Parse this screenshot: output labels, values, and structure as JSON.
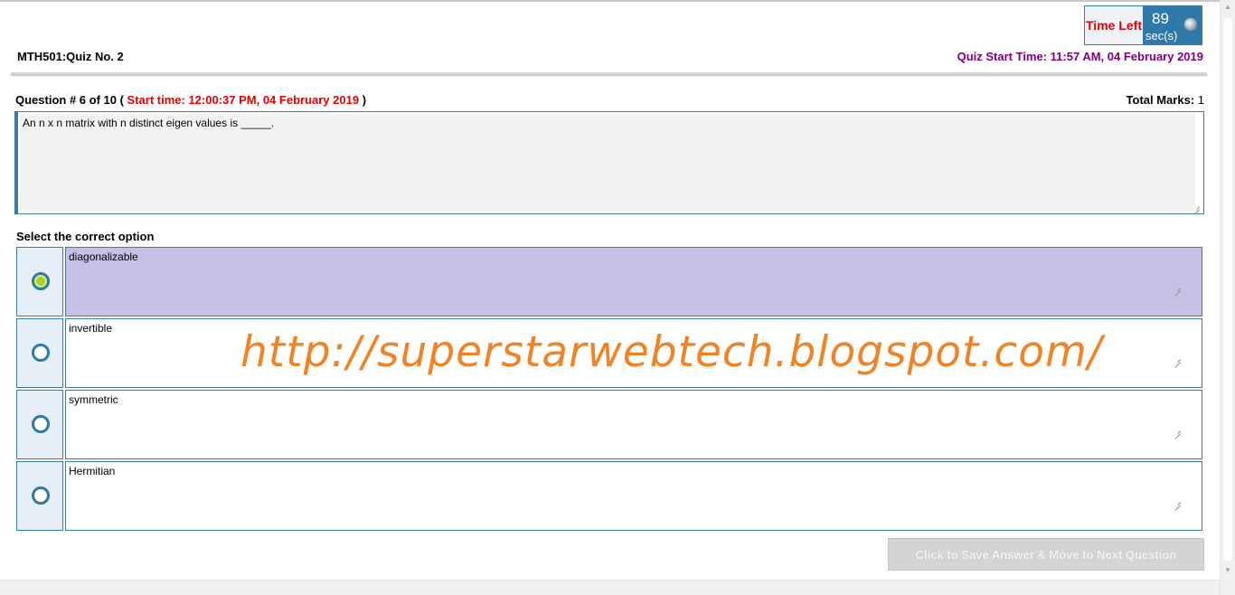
{
  "timer": {
    "label": "Time Left",
    "value": "89",
    "unit": "sec(s)"
  },
  "quiz": {
    "title": "MTH501:Quiz No. 2",
    "start_time": "Quiz Start Time: 11:57 AM, 04 February 2019"
  },
  "question": {
    "number_text": "Question # 6 of 10 (",
    "start_time": "Start time: 12:00:37 PM, 04 February 2019",
    "close_paren": ")",
    "total_marks_label": "Total Marks:",
    "total_marks_value": "1",
    "text": "An n x n matrix with n distinct eigen values is _____."
  },
  "select_label": "Select the correct option",
  "options": [
    {
      "text": "diagonalizable",
      "selected": true
    },
    {
      "text": "invertible",
      "selected": false
    },
    {
      "text": "symmetric",
      "selected": false
    },
    {
      "text": "Hermitian",
      "selected": false
    }
  ],
  "watermark": "http://superstarwebtech.blogspot.com/",
  "next_button": "Click to Save Answer & Move to Next Question",
  "colors": {
    "accent": "#2f79a8",
    "selected_option": "#c8c0e4",
    "radio_checked": "#a6d22a",
    "alert": "#e00000",
    "quiz_start": "#800080",
    "watermark": "#f08326"
  }
}
